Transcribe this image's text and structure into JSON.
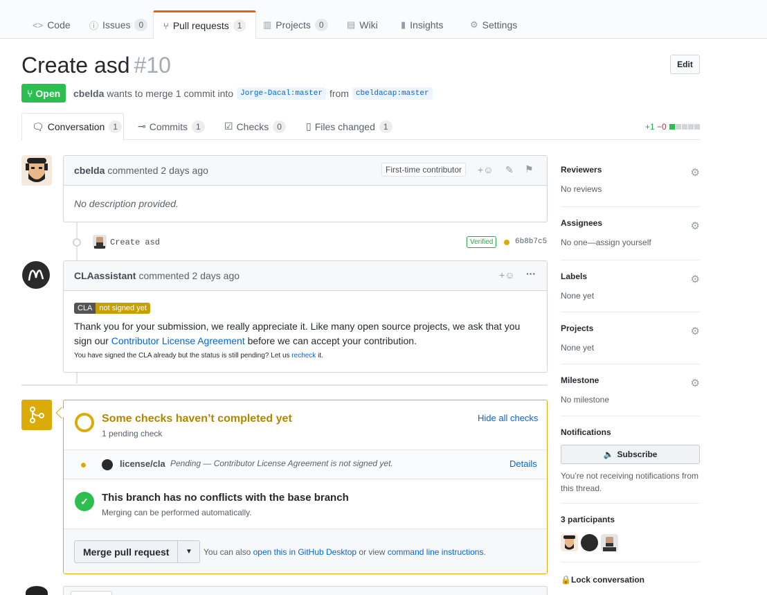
{
  "repo_nav": {
    "tabs": [
      {
        "label": "Code",
        "count": ""
      },
      {
        "label": "Issues",
        "count": "0"
      },
      {
        "label": "Pull requests",
        "count": "1"
      },
      {
        "label": "Projects",
        "count": "0"
      },
      {
        "label": "Wiki",
        "count": ""
      },
      {
        "label": "Insights",
        "count": ""
      },
      {
        "label": "Settings",
        "count": ""
      }
    ]
  },
  "pr": {
    "title": "Create asd",
    "number": "#10",
    "edit_label": "Edit",
    "state": "Open",
    "author": "cbelda",
    "merge_text_1": "wants to merge 1 commit into",
    "base_branch": "Jorge-Dacal:master",
    "from_text": "from",
    "head_branch": "cbeldacap:master"
  },
  "pr_tabs": [
    {
      "label": "Conversation",
      "count": "1"
    },
    {
      "label": "Commits",
      "count": "1"
    },
    {
      "label": "Checks",
      "count": "0"
    },
    {
      "label": "Files changed",
      "count": "1"
    }
  ],
  "diffstat": {
    "added": "+1",
    "removed": "−0"
  },
  "comment1": {
    "author": "cbelda",
    "action": "commented",
    "time": "2 days ago",
    "badge": "First-time contributor",
    "add_reaction": "+",
    "body": "No description provided."
  },
  "commit": {
    "message": "Create asd",
    "verified": "Verified",
    "sha": "6b8b7c5"
  },
  "comment2": {
    "author": "CLAassistant",
    "action": "commented",
    "time": "2 days ago",
    "more": "···",
    "add_reaction": "+",
    "cla_label": "CLA",
    "cla_status": "not signed yet",
    "body_1": "Thank you for your submission, we really appreciate it. Like many open source projects, we ask that you sign our",
    "link": "Contributor License Agreement",
    "body_2": "before we can accept your contribution.",
    "small_1": "You have signed the CLA already but the status is still pending? Let us",
    "small_link": "recheck",
    "small_2": "it."
  },
  "merge": {
    "checks_title": "Some checks haven’t completed yet",
    "checks_sub": "1 pending check",
    "hide_checks": "Hide all checks",
    "check_name": "license/cla",
    "check_desc": "Pending — Contributor License Agreement is not signed yet.",
    "details": "Details",
    "conflict_title": "This branch has no conflicts with the base branch",
    "conflict_sub": "Merging can be performed automatically.",
    "merge_button": "Merge pull request",
    "also_1": "You can also",
    "desktop_link": "open this in GitHub Desktop",
    "also_2": "or view",
    "cli_link": "command line instructions",
    "also_3": "."
  },
  "sidebar": {
    "reviewers": {
      "title": "Reviewers",
      "value": "No reviews"
    },
    "assignees": {
      "title": "Assignees",
      "value": "No one—assign yourself"
    },
    "labels": {
      "title": "Labels",
      "value": "None yet"
    },
    "projects": {
      "title": "Projects",
      "value": "None yet"
    },
    "milestone": {
      "title": "Milestone",
      "value": "No milestone"
    },
    "notifications": {
      "title": "Notifications",
      "subscribe": "Subscribe",
      "note": "You’re not receiving notifications from this thread."
    },
    "participants": {
      "title": "3 participants"
    },
    "lock": "Lock conversation"
  },
  "colors": {
    "accent": "#e36209",
    "open": "#2cbe4e",
    "pending": "#dbab09",
    "link": "#0366d6"
  }
}
